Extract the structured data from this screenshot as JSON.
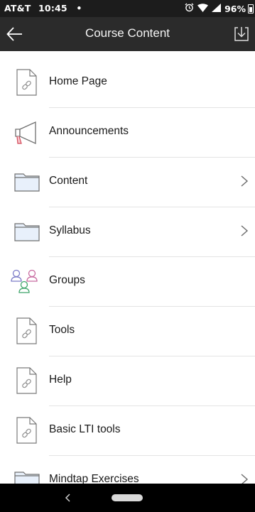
{
  "status_bar": {
    "carrier": "AT&T",
    "time": "10:45",
    "dot": "•",
    "battery": "96%"
  },
  "app_bar": {
    "title": "Course Content"
  },
  "items": [
    {
      "label": "Home Page",
      "icon": "document-link-icon",
      "chevron": false
    },
    {
      "label": "Announcements",
      "icon": "megaphone-icon",
      "chevron": false
    },
    {
      "label": "Content",
      "icon": "folder-icon",
      "chevron": true
    },
    {
      "label": "Syllabus",
      "icon": "folder-icon",
      "chevron": true
    },
    {
      "label": "Groups",
      "icon": "groups-icon",
      "chevron": false
    },
    {
      "label": "Tools",
      "icon": "document-link-icon",
      "chevron": false
    },
    {
      "label": "Help",
      "icon": "document-link-icon",
      "chevron": false
    },
    {
      "label": "Basic LTI tools",
      "icon": "document-link-icon",
      "chevron": false
    },
    {
      "label": "Mindtap Exercises",
      "icon": "folder-icon",
      "chevron": true
    }
  ],
  "colors": {
    "status_bar": "#1c1c1c",
    "app_bar": "#2b2b2b",
    "divider": "#e4e4e4",
    "folder_fill": "#e8f0fb",
    "icon_stroke": "#6f6f6f"
  }
}
